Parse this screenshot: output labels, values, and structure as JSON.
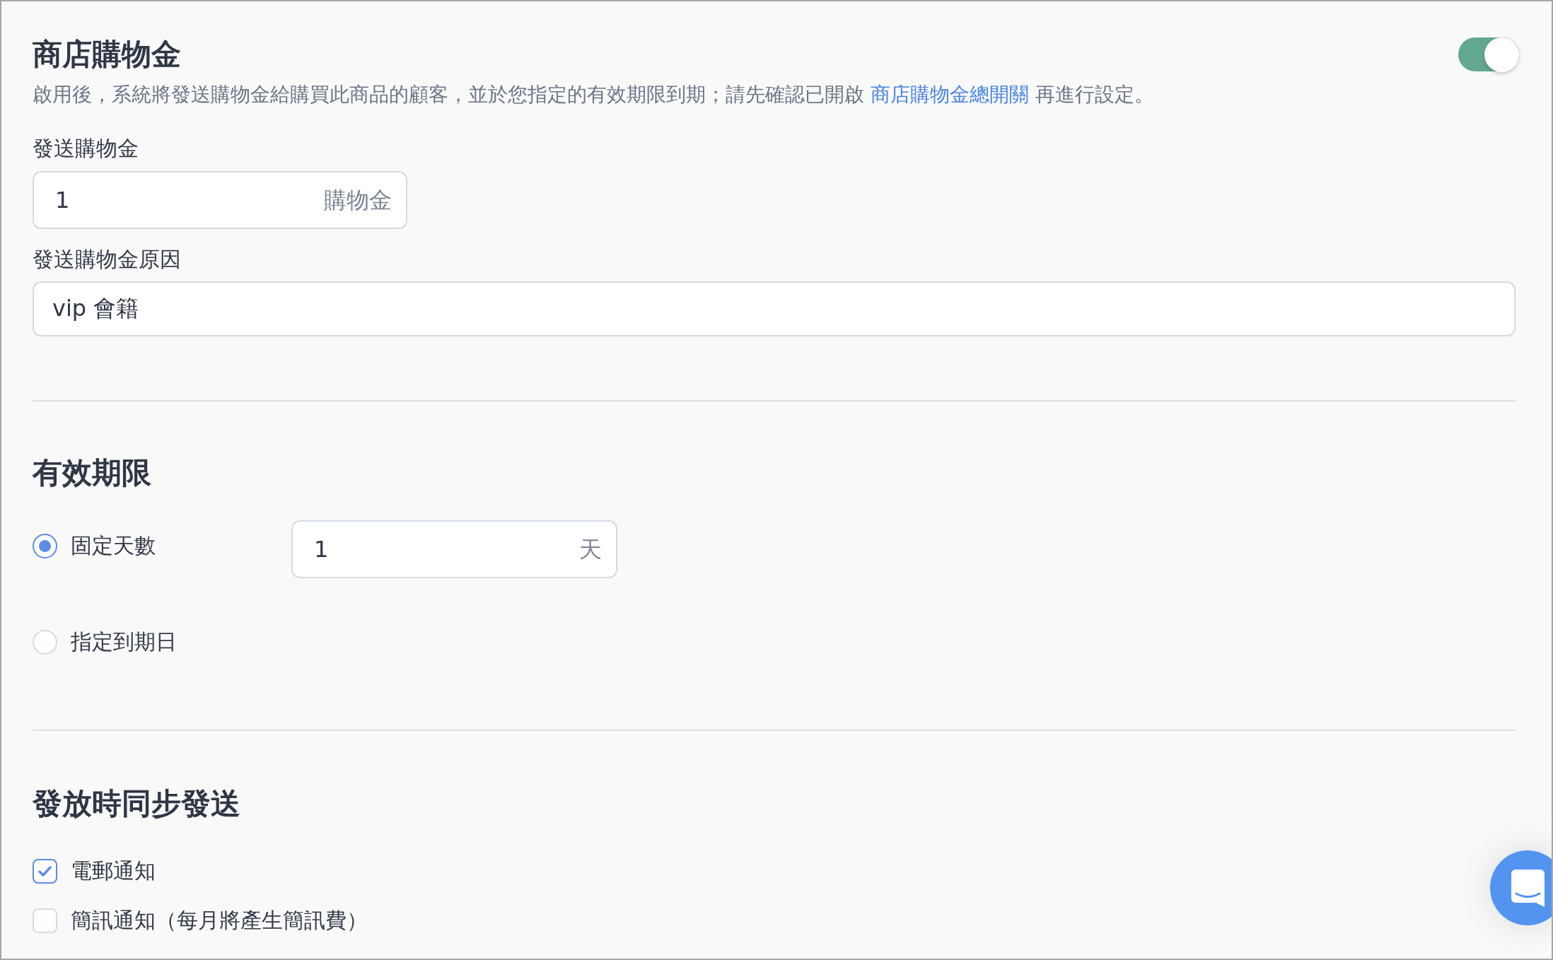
{
  "store_credit": {
    "title": "商店購物金",
    "enabled": true,
    "description": {
      "text": "啟用後，系統將發送購物金給購買此商品的顧客，並於您指定的有效期限到期；請先確認已開啟",
      "link": "商店購物金總開關",
      "text_after": "再進行設定。"
    }
  },
  "credit_amount": {
    "label": "發送購物金",
    "value": "1",
    "suffix": "購物金"
  },
  "credit_reason": {
    "label": "發送購物金原因",
    "value": "vip 會籍"
  },
  "validity": {
    "title": "有效期限",
    "options": [
      {
        "label": "固定天數",
        "selected": true,
        "field": {
          "value": "1",
          "suffix": "天"
        }
      },
      {
        "label": "指定到期日",
        "selected": false
      }
    ]
  },
  "sync_send": {
    "title": "發放時同步發送",
    "options": [
      {
        "label": "電郵通知",
        "checked": true
      },
      {
        "label": "簡訊通知（每月將產生簡訊費）",
        "checked": false
      }
    ]
  }
}
